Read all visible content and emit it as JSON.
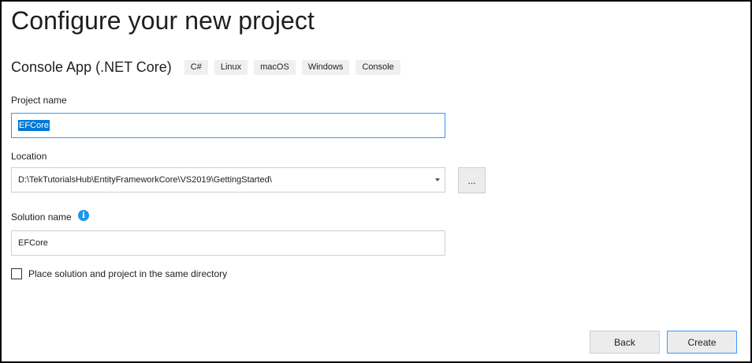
{
  "page": {
    "title": "Configure your new project"
  },
  "template": {
    "name": "Console App (.NET Core)",
    "tags": [
      "C#",
      "Linux",
      "macOS",
      "Windows",
      "Console"
    ]
  },
  "form": {
    "project_name": {
      "label": "Project name",
      "value": "EFCore"
    },
    "location": {
      "label": "Location",
      "value": "D:\\TekTutorialsHub\\EntityFrameworkCore\\VS2019\\GettingStarted\\",
      "browse_label": "..."
    },
    "solution_name": {
      "label": "Solution name",
      "value": "EFCore",
      "info_glyph": "i"
    },
    "same_directory": {
      "label": "Place solution and project in the same directory",
      "checked": false
    }
  },
  "footer": {
    "back_label": "Back",
    "create_label": "Create"
  },
  "colors": {
    "accent": "#3399ff",
    "selection": "#0078d7",
    "info": "#1c97ea"
  }
}
